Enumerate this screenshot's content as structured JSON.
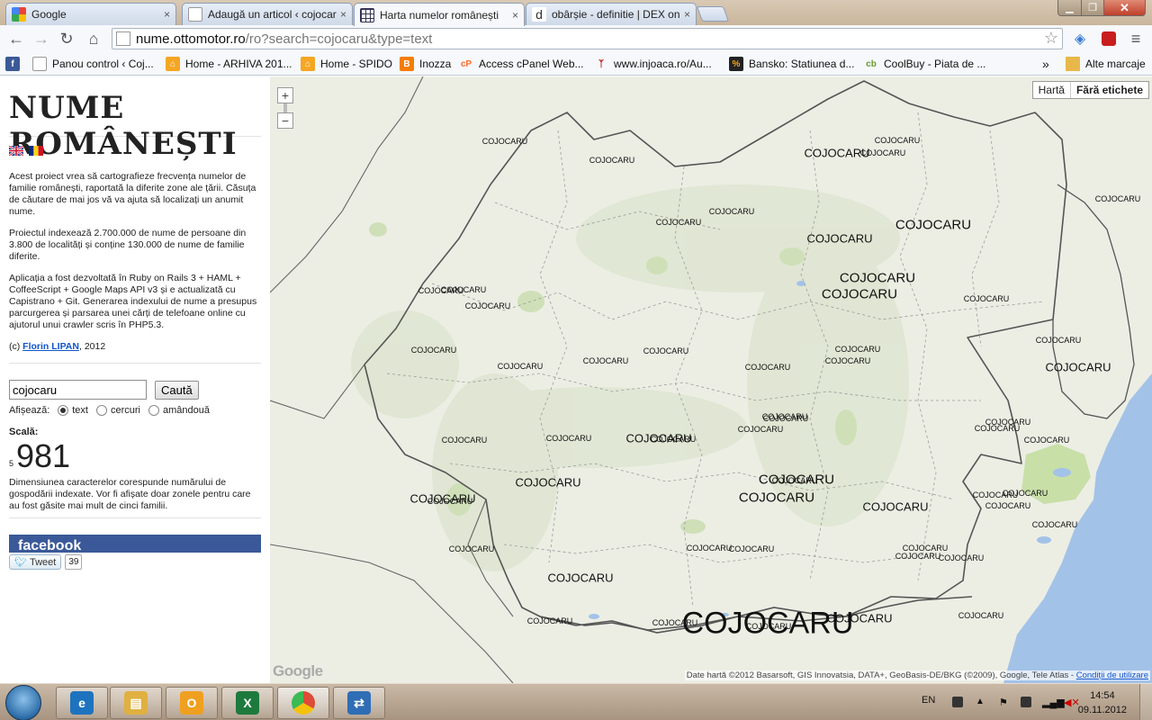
{
  "browser": {
    "tabs": [
      {
        "title": "Google",
        "active": false
      },
      {
        "title": "Adaugă un articol ‹ cojocaru",
        "active": false
      },
      {
        "title": "Harta numelor românești",
        "active": true
      },
      {
        "title": "obârșie - definitie | DEX onl",
        "active": false
      }
    ],
    "close_glyph": "×",
    "url_host": "nume.ottomotor.ro",
    "url_path": "/ro?search=cojocaru&type=text",
    "bookmarks": [
      {
        "label": "",
        "icon": "facebook-icon",
        "color": "#3b5998"
      },
      {
        "label": "Panou control ‹ Coj...",
        "icon": "page-icon",
        "color": "#ffffff"
      },
      {
        "label": "Home - ARHIVA 201...",
        "icon": "home-icon",
        "color": "#f5a623"
      },
      {
        "label": "Home - SPIDO",
        "icon": "home-icon",
        "color": "#f5a623"
      },
      {
        "label": "Inozza",
        "icon": "blogger-icon",
        "color": "#f57d00"
      },
      {
        "label": "Access cPanel Web...",
        "icon": "cpanel-icon",
        "color": "#ff6c2c"
      },
      {
        "label": "www.injoaca.ro/Au...",
        "icon": "injoaca-icon",
        "color": "#c00000"
      },
      {
        "label": "Bansko: Statiunea d...",
        "icon": "percent-icon",
        "color": "#222222"
      },
      {
        "label": "CoolBuy - Piata de ...",
        "icon": "coolbuy-icon",
        "color": "#ffffff"
      }
    ],
    "bookmarks_overflow": "»",
    "other_bookmarks": "Alte marcaje"
  },
  "sidebar": {
    "site_title": "NUME ROMÂNEȘTI",
    "intro_paragraphs": [
      "Acest proiect vrea să cartografieze frecvența numelor de familie românești, raportată la diferite zone ale țării. Căsuța de căutare de mai jos vă va ajuta să localizați un anumit nume.",
      "Proiectul indexează 2.700.000 de nume de persoane din 3.800 de localități și conține 130.000 de nume de familie diferite.",
      "Aplicația a fost dezvoltată în Ruby on Rails 3 + HAML + CoffeeScript + Google Maps API v3 și e actualizată cu Capistrano + Git. Generarea indexului de nume a presupus parcurgerea și parsarea unei cărți de telefoane online cu ajutorul unui crawler scris în PHP5.3."
    ],
    "credit_prefix": "(c) ",
    "credit_author": "Florin LIPAN",
    "credit_suffix": ", 2012",
    "search_value": "cojocaru",
    "search_button": "Caută",
    "show_label": "Afișează:",
    "show_options": [
      {
        "label": "text",
        "selected": true
      },
      {
        "label": "cercuri",
        "selected": false
      },
      {
        "label": "amândouă",
        "selected": false
      }
    ],
    "scale_label": "Scală:",
    "scale_min": "5",
    "scale_max": "981",
    "scale_description": "Dimensiunea caracterelor corespunde numărului de gospodării indexate. Vor fi afișate doar zonele pentru care au fost găsite mai mult de cinci familii.",
    "facebook_label": "facebook",
    "tweet_label": "Tweet",
    "tweet_count": "39"
  },
  "map": {
    "map_type_buttons": [
      {
        "label": "Hartă",
        "active": false
      },
      {
        "label": "Fără etichete",
        "active": true
      }
    ],
    "zoom_in": "+",
    "zoom_out": "−",
    "google_logo": "Google",
    "attribution": "Date hartă ©2012 Basarsoft, GIS Innovatsia, DATA+, GeoBasis-DE/BKG (©2009), Google, Tele Atlas - ",
    "terms_link": "Condiții de utilizare",
    "labels": [
      {
        "text": "COJOCARU",
        "size": "s"
      },
      {
        "text": "COJOCARU",
        "size": "s"
      },
      {
        "text": "COJOCARU",
        "size": "s"
      },
      {
        "text": "COJOCARU",
        "size": "s"
      },
      {
        "text": "COJOCARU",
        "size": "s"
      },
      {
        "text": "COJOCARU",
        "size": "s"
      },
      {
        "text": "COJOCARU",
        "size": "m"
      },
      {
        "text": "COJOCARU",
        "size": "s"
      },
      {
        "text": "COJOCARU",
        "size": "m"
      },
      {
        "text": "COJOCARU",
        "size": "l"
      },
      {
        "text": "COJOCARU",
        "size": "s"
      },
      {
        "text": "COJOCARU",
        "size": "s"
      },
      {
        "text": "COJOCARU",
        "size": "l"
      },
      {
        "text": "COJOCARU",
        "size": "l"
      },
      {
        "text": "COJOCARU",
        "size": "s"
      },
      {
        "text": "COJOCARU",
        "size": "s"
      },
      {
        "text": "COJOCARU",
        "size": "s"
      },
      {
        "text": "COJOCARU",
        "size": "s"
      },
      {
        "text": "COJOCARU",
        "size": "s"
      },
      {
        "text": "COJOCARU",
        "size": "s"
      },
      {
        "text": "COJOCARU",
        "size": "s"
      },
      {
        "text": "COJOCARU",
        "size": "s"
      },
      {
        "text": "COJOCARU",
        "size": "s"
      },
      {
        "text": "COJOCARU",
        "size": "s"
      },
      {
        "text": "COJOCARU",
        "size": "m"
      },
      {
        "text": "COJOCARU",
        "size": "s"
      },
      {
        "text": "COJOCARU",
        "size": "s"
      },
      {
        "text": "COJOCARU",
        "size": "s"
      },
      {
        "text": "COJOCARU",
        "size": "s"
      },
      {
        "text": "COJOCARU",
        "size": "s"
      },
      {
        "text": "COJOCARU",
        "size": "s"
      },
      {
        "text": "COJOCARU",
        "size": "m"
      },
      {
        "text": "COJOCARU",
        "size": "s"
      },
      {
        "text": "COJOCARU",
        "size": "m"
      },
      {
        "text": "COJOCARU",
        "size": "m"
      },
      {
        "text": "COJOCARU",
        "size": "s"
      },
      {
        "text": "COJOCARU",
        "size": "s"
      },
      {
        "text": "COJOCARU",
        "size": "s"
      },
      {
        "text": "COJOCARU",
        "size": "s"
      },
      {
        "text": "COJOCARU",
        "size": "s"
      },
      {
        "text": "COJOCARU",
        "size": "l"
      },
      {
        "text": "COJOCARU",
        "size": "l"
      },
      {
        "text": "COJOCARU",
        "size": "m"
      },
      {
        "text": "COJOCARU",
        "size": "s"
      },
      {
        "text": "COJOCARU",
        "size": "s"
      },
      {
        "text": "COJOCARU",
        "size": "s"
      },
      {
        "text": "COJOCARU",
        "size": "s"
      },
      {
        "text": "COJOCARU",
        "size": "s"
      },
      {
        "text": "COJOCARU",
        "size": "m"
      },
      {
        "text": "COJOCARU",
        "size": "s"
      },
      {
        "text": "COJOCARU",
        "size": "s"
      },
      {
        "text": "COJOCARU",
        "size": "s"
      },
      {
        "text": "COJOCARU",
        "size": "s"
      },
      {
        "text": "COJOCARU",
        "size": "s"
      },
      {
        "text": "COJOCARU",
        "size": "s"
      },
      {
        "text": "COJOCARU",
        "size": "s"
      },
      {
        "text": "COJOCARU",
        "size": "s"
      },
      {
        "text": "COJOCARU",
        "size": "xl"
      },
      {
        "text": "COJOCARU",
        "size": "m"
      }
    ]
  },
  "taskbar": {
    "apps": [
      {
        "name": "internet-explorer",
        "color": "#1e73be",
        "glyph": "e"
      },
      {
        "name": "file-explorer",
        "color": "#e0b040",
        "glyph": "▤"
      },
      {
        "name": "outlook",
        "color": "#f0a020",
        "glyph": "O"
      },
      {
        "name": "excel",
        "color": "#1e7a3c",
        "glyph": "X"
      },
      {
        "name": "chrome",
        "color": "#dd4b39",
        "glyph": "◉"
      },
      {
        "name": "remote-app",
        "color": "#2f6db5",
        "glyph": "⇄"
      }
    ],
    "language": "EN",
    "time": "14:54",
    "date": "09.11.2012"
  }
}
